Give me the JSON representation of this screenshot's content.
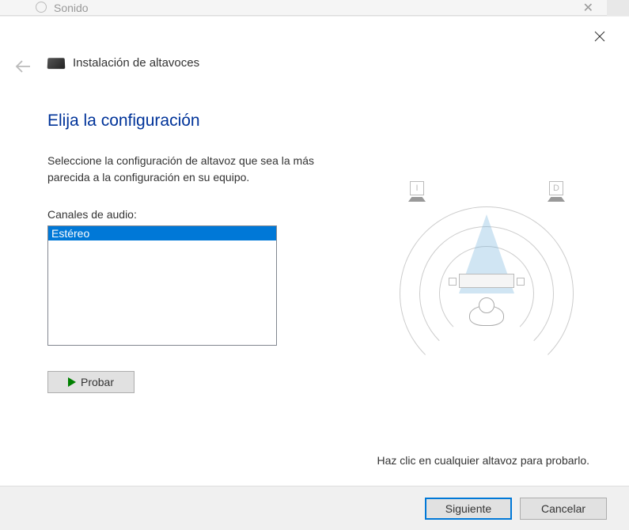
{
  "background": {
    "title": "Sonido"
  },
  "dialog": {
    "title": "Instalación de altavoces",
    "heading": "Elija la configuración",
    "description": "Seleccione la configuración de altavoz que sea la más parecida a la configuración en su equipo.",
    "channels_label": "Canales de audio:",
    "channels": [
      {
        "label": "Estéreo",
        "selected": true
      }
    ],
    "test_button": "Probar",
    "speaker_left": "I",
    "speaker_right": "D",
    "hint": "Haz clic en cualquier altavoz para probarlo.",
    "next_button": "Siguiente",
    "cancel_button": "Cancelar"
  }
}
